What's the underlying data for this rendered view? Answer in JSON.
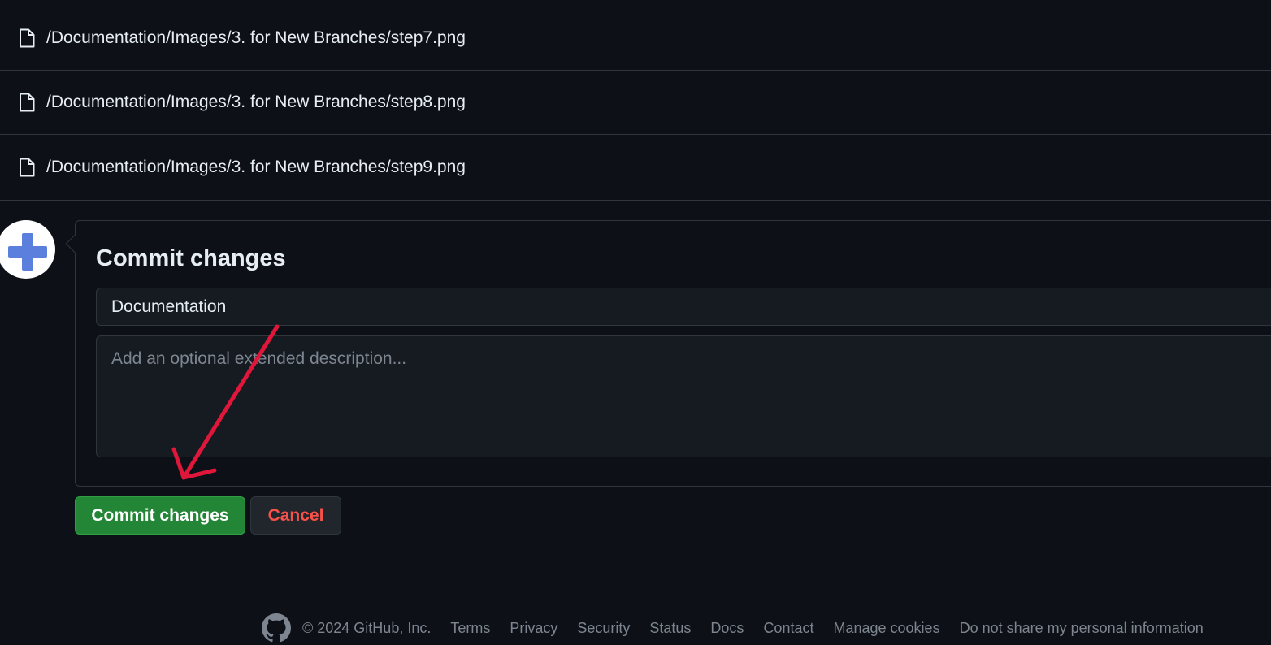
{
  "files": [
    {
      "path": "/Documentation/Images/3. for New Branches/step7.png",
      "icon": "file-icon"
    },
    {
      "path": "/Documentation/Images/3. for New Branches/step8.png",
      "icon": "file-icon"
    },
    {
      "path": "/Documentation/Images/3. for New Branches/step9.png",
      "icon": "file-icon"
    }
  ],
  "commit": {
    "title": "Commit changes",
    "summary_value": "Documentation",
    "description_placeholder": "Add an optional extended description...",
    "commit_button_label": "Commit changes",
    "cancel_button_label": "Cancel"
  },
  "footer": {
    "copyright": "© 2024 GitHub, Inc.",
    "links": [
      "Terms",
      "Privacy",
      "Security",
      "Status",
      "Docs",
      "Contact",
      "Manage cookies",
      "Do not share my personal information"
    ]
  },
  "colors": {
    "background": "#0d1117",
    "commit_button": "#238636",
    "cancel_text": "#f85149",
    "annotation_arrow": "#e0173a",
    "avatar_cross": "#5a7fdc"
  }
}
